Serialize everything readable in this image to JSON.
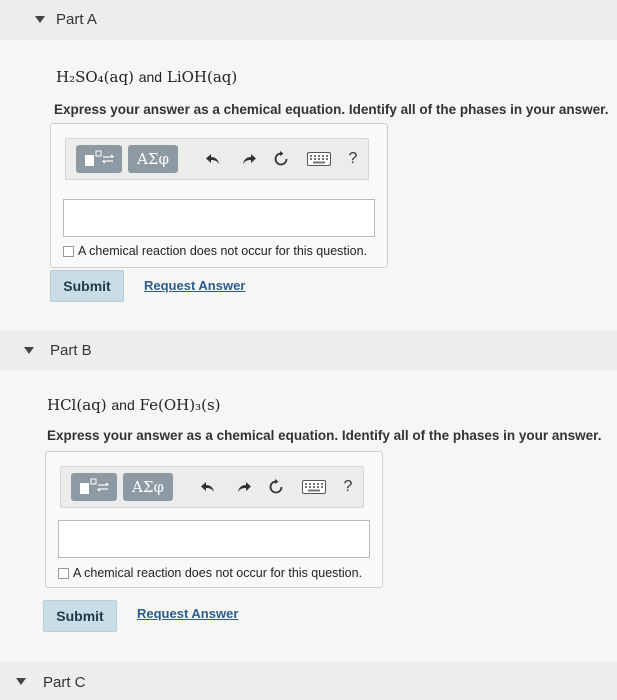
{
  "parts": [
    {
      "label": "Part A",
      "question": {
        "reactant1": "H₂SO₄(aq)",
        "connector": "and",
        "reactant2": "LiOH(aq)"
      },
      "instruction": "Express your answer as a chemical equation. Identify all of the phases in your answer.",
      "toolbar": {
        "greek_label": "ΑΣφ",
        "help_label": "?"
      },
      "answer_value": "",
      "no_reaction_label": "A chemical reaction does not occur for this question.",
      "submit_label": "Submit",
      "request_label": "Request Answer"
    },
    {
      "label": "Part B",
      "question": {
        "reactant1": "HCl(aq)",
        "connector": "and",
        "reactant2": "Fe(OH)₃(s)"
      },
      "instruction": "Express your answer as a chemical equation. Identify all of the phases in your answer.",
      "toolbar": {
        "greek_label": "ΑΣφ",
        "help_label": "?"
      },
      "answer_value": "",
      "no_reaction_label": "A chemical reaction does not occur for this question.",
      "submit_label": "Submit",
      "request_label": "Request Answer"
    },
    {
      "label": "Part C"
    }
  ]
}
